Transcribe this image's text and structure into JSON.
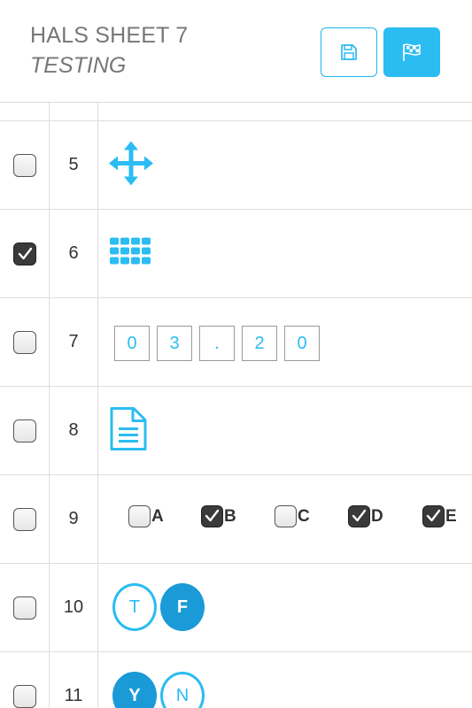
{
  "header": {
    "title": "HALS SHEET 7",
    "subtitle": "TESTING",
    "save_icon": "floppy-disk-icon",
    "flag_icon": "checkered-flag-icon"
  },
  "colors": {
    "accent": "#2bbcf2",
    "accent_dark": "#1a9ad6"
  },
  "rows": [
    {
      "num": "5",
      "checked": false,
      "content": "move-arrows-icon"
    },
    {
      "num": "6",
      "checked": true,
      "content": "grid-dots-icon"
    },
    {
      "num": "7",
      "checked": false,
      "digits": [
        "0",
        "3",
        ".",
        "2",
        "0"
      ]
    },
    {
      "num": "8",
      "checked": false,
      "content": "document-icon"
    },
    {
      "num": "9",
      "checked": false,
      "options": [
        {
          "label": "A",
          "checked": false
        },
        {
          "label": "B",
          "checked": true
        },
        {
          "label": "C",
          "checked": false
        },
        {
          "label": "D",
          "checked": true
        },
        {
          "label": "E",
          "checked": true
        }
      ]
    },
    {
      "num": "10",
      "checked": false,
      "choices": [
        {
          "label": "T",
          "selected": false
        },
        {
          "label": "F",
          "selected": true
        }
      ]
    },
    {
      "num": "11",
      "checked": false,
      "choices": [
        {
          "label": "Y",
          "selected": true
        },
        {
          "label": "N",
          "selected": false
        }
      ]
    }
  ]
}
